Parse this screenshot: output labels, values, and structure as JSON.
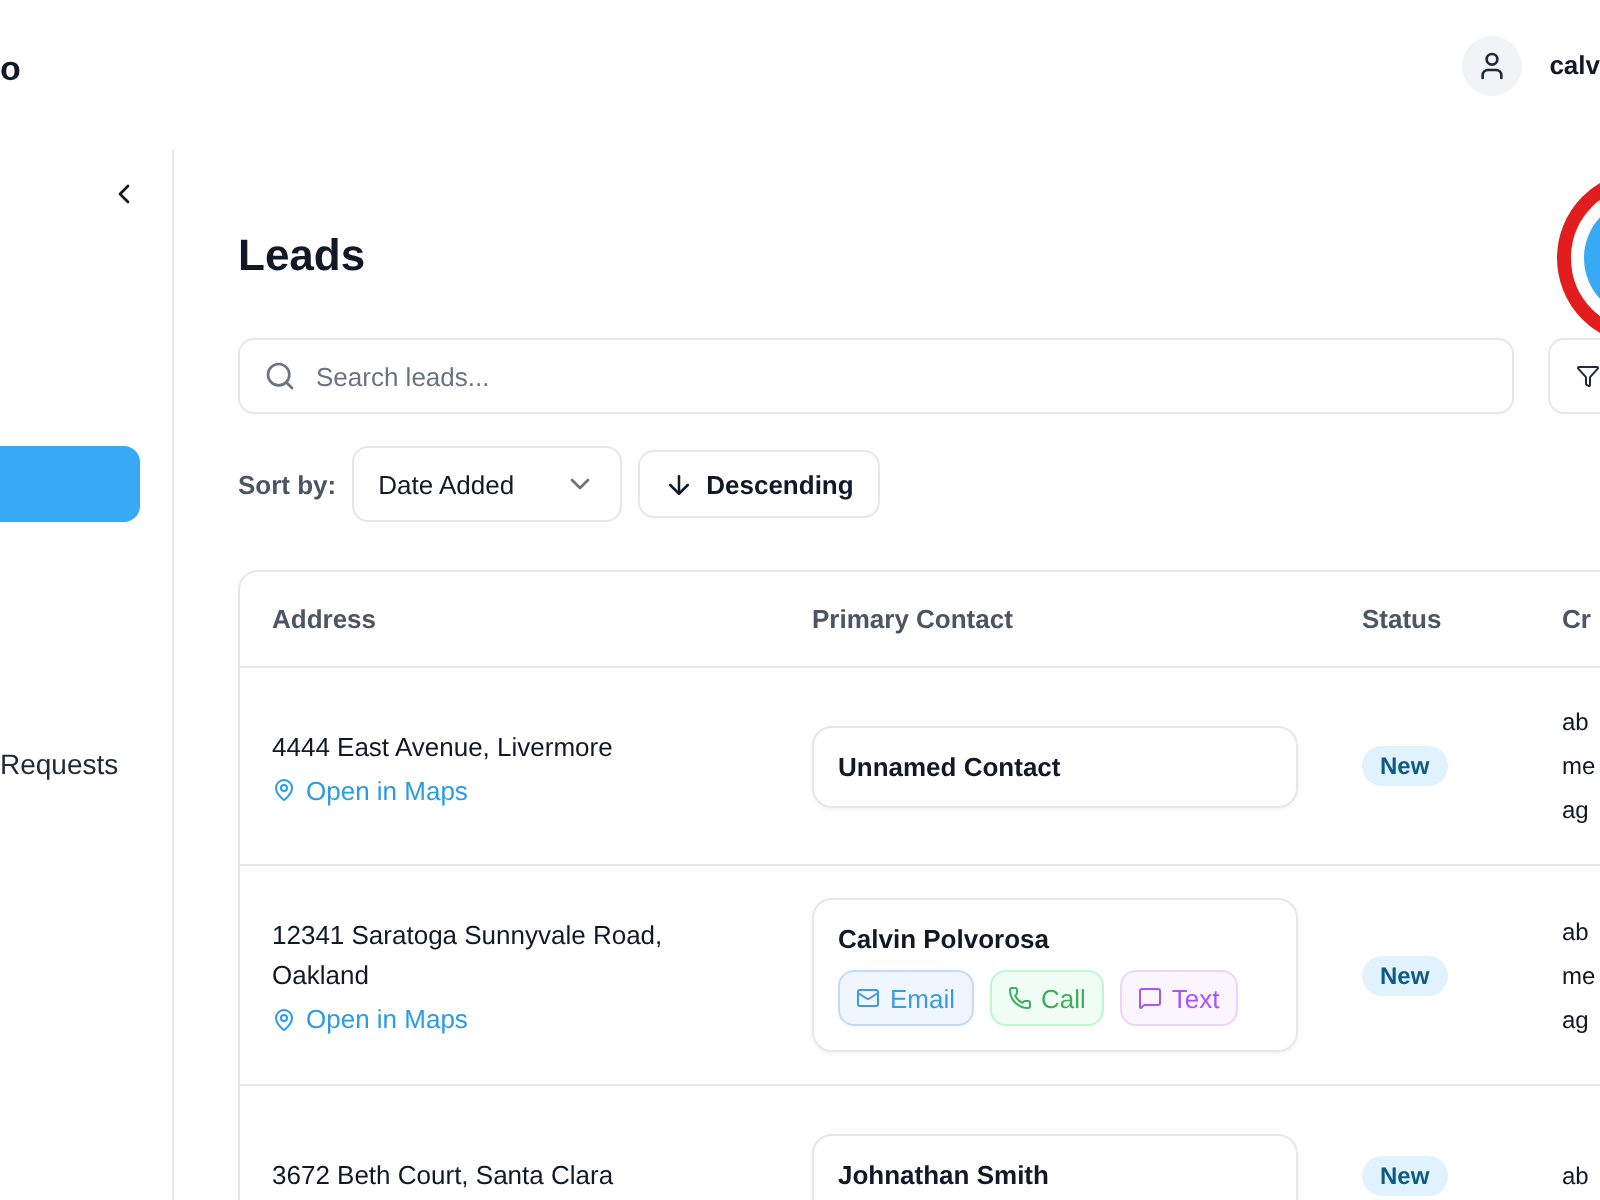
{
  "header": {
    "logo": "o",
    "user": "calv"
  },
  "sidebar": {
    "items": [
      {
        "selected": true
      },
      {
        "label": "Requests",
        "selected": false
      }
    ]
  },
  "page": {
    "title": "Leads"
  },
  "search": {
    "placeholder": "Search leads..."
  },
  "sort": {
    "label": "Sort by:",
    "field": "Date Added",
    "direction": "Descending"
  },
  "table": {
    "columns": [
      "Address",
      "Primary Contact",
      "Status",
      "Cr"
    ],
    "rows": [
      {
        "address": "4444 East Avenue, Livermore",
        "maps": "Open in Maps",
        "contact": "Unnamed Contact",
        "actions": [],
        "status": "New",
        "column_4": [
          "ab",
          "me",
          "ag"
        ]
      },
      {
        "address": "12341 Saratoga Sunnyvale Road, Oakland",
        "maps": "Open in Maps",
        "contact": "Calvin Polvorosa",
        "actions": [
          {
            "kind": "email",
            "label": "Email"
          },
          {
            "kind": "call",
            "label": "Call"
          },
          {
            "kind": "text",
            "label": "Text"
          }
        ],
        "status": "New",
        "column_4": [
          "ab",
          "me",
          "ag"
        ]
      },
      {
        "address": "3672 Beth Court, Santa Clara",
        "contact": "Johnathan Smith",
        "actions": [],
        "status": "New",
        "column_4": [
          "ab"
        ]
      }
    ]
  }
}
